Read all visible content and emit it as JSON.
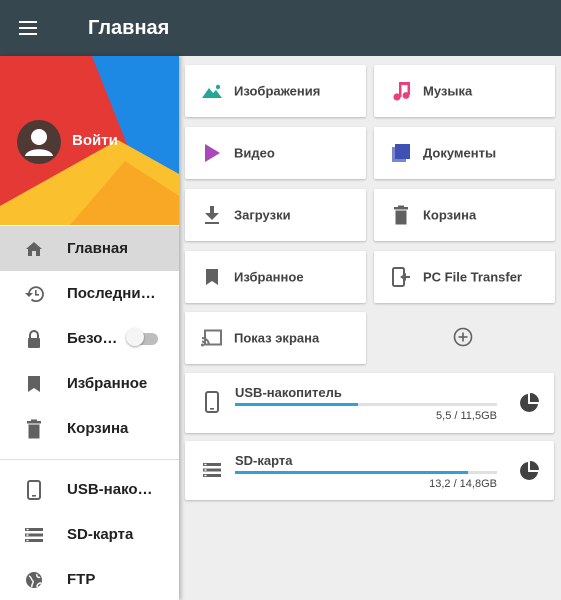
{
  "appbar": {
    "title": "Главная",
    "menu_icon": "hamburger-menu-icon"
  },
  "drawer": {
    "header": {
      "login_label": "Войти",
      "colors": {
        "red": "#e53935",
        "blue": "#1e88e5",
        "yellow": "#fbc02d"
      }
    },
    "items": [
      {
        "label": "Главная",
        "icon": "home-icon",
        "active": true
      },
      {
        "label": "Последни…",
        "icon": "history-icon"
      },
      {
        "label": "Безо…",
        "icon": "lock-icon",
        "toggle": false
      },
      {
        "label": "Избранное",
        "icon": "bookmark-icon"
      },
      {
        "label": "Корзина",
        "icon": "trash-icon"
      }
    ],
    "storage_items": [
      {
        "label": "USB-нако…",
        "icon": "phone-icon"
      },
      {
        "label": "SD-карта",
        "icon": "storage-icon"
      },
      {
        "label": "FTP",
        "icon": "globe-icon"
      }
    ]
  },
  "categories": [
    {
      "label": "Изображения",
      "icon": "image-icon",
      "color": "#26a69a"
    },
    {
      "label": "Музыка",
      "icon": "music-note-icon",
      "color": "#ec407a"
    },
    {
      "label": "Видео",
      "icon": "play-icon",
      "color": "#ab47bc"
    },
    {
      "label": "Документы",
      "icon": "document-icon",
      "color": "#3f51b5"
    },
    {
      "label": "Загрузки",
      "icon": "download-icon",
      "color": "#616161"
    },
    {
      "label": "Корзина",
      "icon": "trash-icon",
      "color": "#616161"
    },
    {
      "label": "Избранное",
      "icon": "bookmark-icon",
      "color": "#616161"
    },
    {
      "label": "PC File Transfer",
      "icon": "pc-transfer-icon",
      "color": "#616161"
    },
    {
      "label": "Показ экрана",
      "icon": "cast-icon",
      "color": "#757575"
    }
  ],
  "add_button": {
    "icon": "add-circle-icon"
  },
  "storage": [
    {
      "name": "USB-накопитель",
      "size": "5,5 / 11,5GB",
      "used_fraction": 0.47,
      "icon": "phone-icon",
      "chart_icon": "pie-chart-icon"
    },
    {
      "name": "SD-карта",
      "size": "13,2 / 14,8GB",
      "used_fraction": 0.89,
      "icon": "storage-icon",
      "chart_icon": "pie-chart-icon"
    }
  ]
}
